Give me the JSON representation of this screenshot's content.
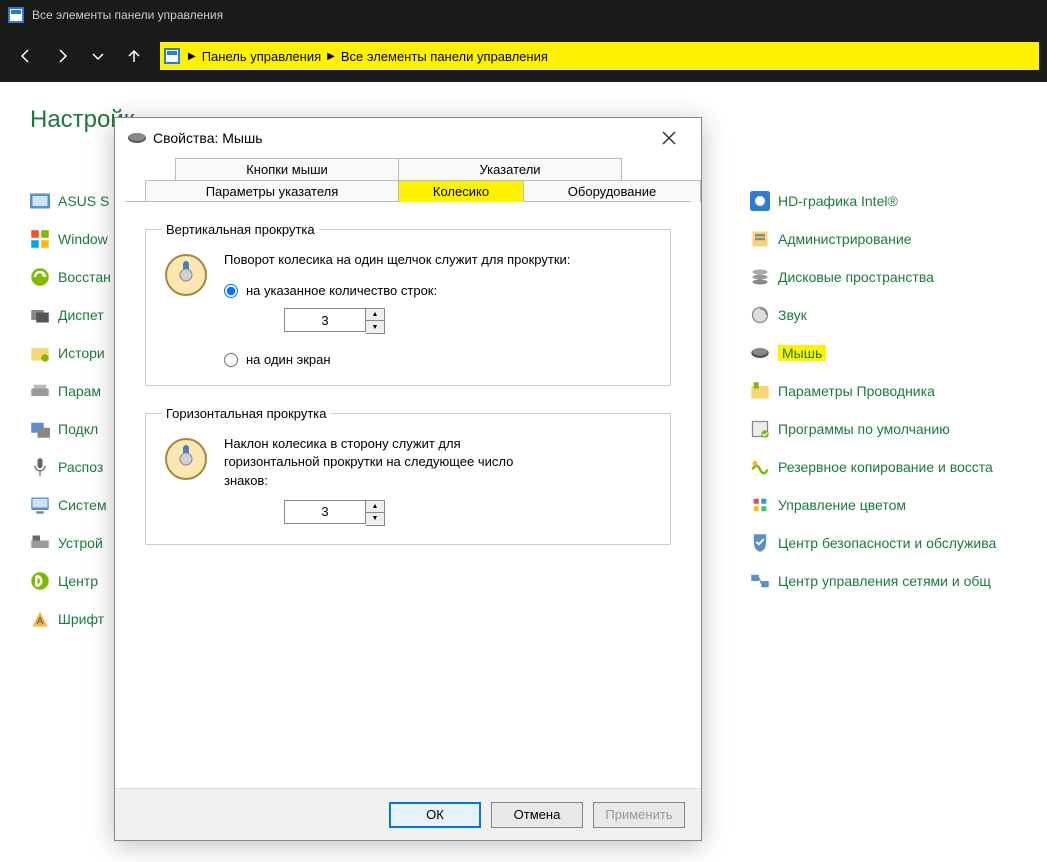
{
  "titlebar": {
    "text": "Все элементы панели управления"
  },
  "breadcrumb": {
    "part1": "Панель управления",
    "part2": "Все элементы панели управления"
  },
  "page": {
    "title": "Настройк"
  },
  "leftItems": [
    {
      "label": "ASUS S"
    },
    {
      "label": "Window"
    },
    {
      "label": "Восстан"
    },
    {
      "label": "Диспет"
    },
    {
      "label": "Истори"
    },
    {
      "label": "Парам"
    },
    {
      "label": "Подкл"
    },
    {
      "label": "Распоз"
    },
    {
      "label": "Систем"
    },
    {
      "label": "Устрой"
    },
    {
      "label": "Центр"
    },
    {
      "label": "Шрифт"
    }
  ],
  "rightItems": [
    {
      "label": "HD-графика Intel®",
      "hl": false
    },
    {
      "label": "Администрирование",
      "hl": false
    },
    {
      "label": "Дисковые пространства",
      "hl": false
    },
    {
      "label": "Звук",
      "hl": false
    },
    {
      "label": "Мышь",
      "hl": true
    },
    {
      "label": "Параметры Проводника",
      "hl": false
    },
    {
      "label": "Программы по умолчанию",
      "hl": false
    },
    {
      "label": "Резервное копирование и восста",
      "hl": false
    },
    {
      "label": "Управление цветом",
      "hl": false
    },
    {
      "label": "Центр безопасности и обслужива",
      "hl": false
    },
    {
      "label": "Центр управления сетями и общ",
      "hl": false
    }
  ],
  "dialog": {
    "title": "Свойства: Мышь",
    "tabs": {
      "r1a": "Кнопки мыши",
      "r1b": "Указатели",
      "r2a": "Параметры указателя",
      "r2b": "Колесико",
      "r2c": "Оборудование"
    },
    "vscroll": {
      "legend": "Вертикальная прокрутка",
      "text": "Поворот колесика на один щелчок служит для прокрутки:",
      "opt1": "на указанное количество строк:",
      "opt2": "на один экран",
      "value": "3"
    },
    "hscroll": {
      "legend": "Горизонтальная прокрутка",
      "text": "Наклон колесика в сторону служит для горизонтальной прокрутки на следующее число знаков:",
      "value": "3"
    },
    "buttons": {
      "ok": "ОК",
      "cancel": "Отмена",
      "apply": "Применить"
    }
  }
}
